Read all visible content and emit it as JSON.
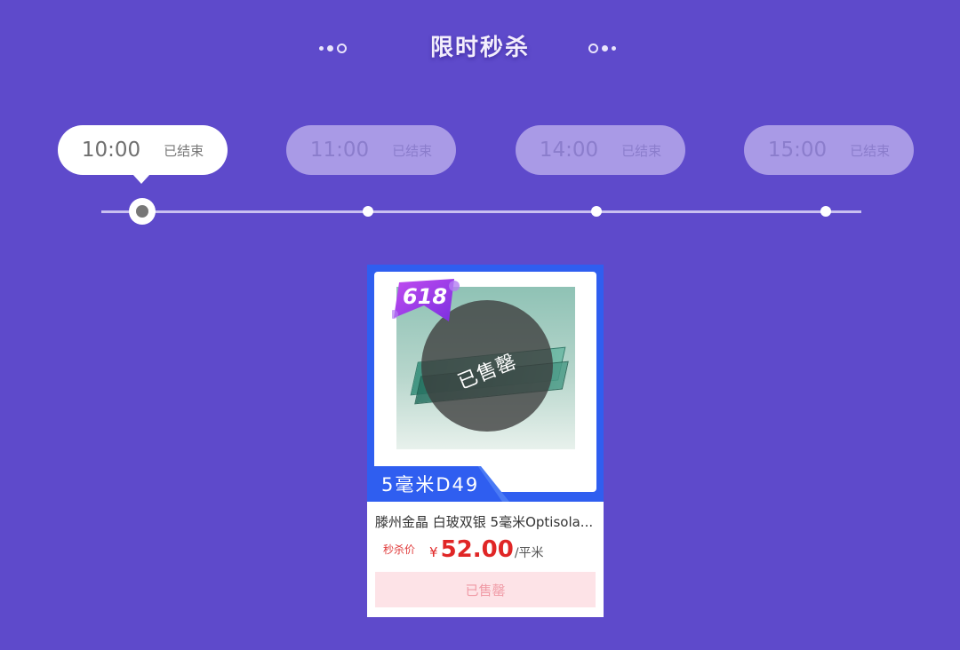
{
  "header": {
    "title": "限时秒杀"
  },
  "time_tabs": [
    {
      "time": "10:00",
      "status": "已结束",
      "active": true
    },
    {
      "time": "11:00",
      "status": "已结束",
      "active": false
    },
    {
      "time": "14:00",
      "status": "已结束",
      "active": false
    },
    {
      "time": "15:00",
      "status": "已结束",
      "active": false
    }
  ],
  "product": {
    "promo_badge": "618",
    "overlay_text": "已售罄",
    "spec_tag": "5毫米D49",
    "name": "滕州金晶 白玻双银 5毫米Optisola...",
    "price_label": "秒杀价",
    "currency": "¥",
    "price": "52.00",
    "unit": "/平米",
    "button_label": "已售罄"
  },
  "colors": {
    "background": "#5e4acb",
    "tab_inactive": "#a99ae6",
    "card_accent": "#2f5ef0",
    "price": "#e02626",
    "soldout_button": "#fde3e7"
  }
}
